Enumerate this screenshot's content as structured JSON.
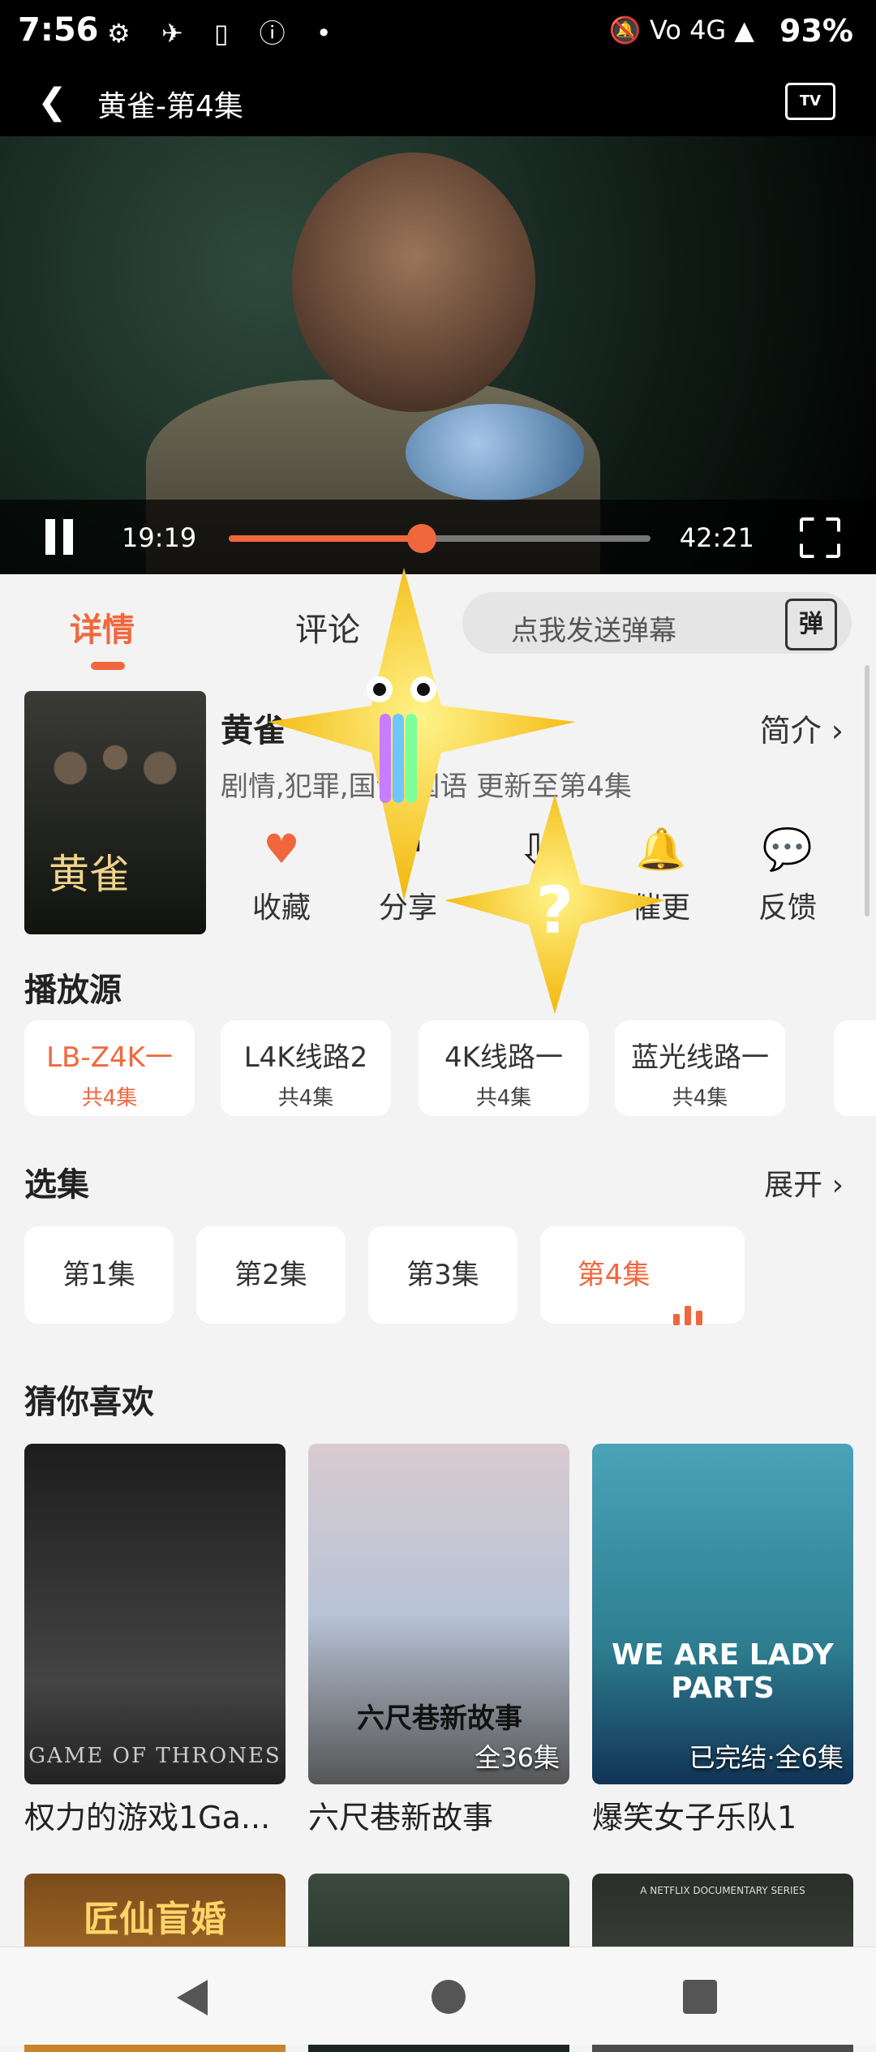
{
  "status_bar": {
    "time": "7:56",
    "left_icons": "⚙ ✈ ▯ ⓘ •",
    "right_icons": "🔕 Vo 4G ▲",
    "battery": "93%"
  },
  "top_bar": {
    "back_label": "❮",
    "title": "黄雀-第4集",
    "tv_label": "TV"
  },
  "player": {
    "current_time": "19:19",
    "total_time": "42:21",
    "progress_fraction": 0.457
  },
  "tabs": {
    "detail": "详情",
    "comment": "评论",
    "danmu_placeholder": "点我发送弹幕",
    "danmu_icon": "弹"
  },
  "show": {
    "title": "黄雀",
    "meta": "剧情,犯罪,国语 国语 更新至第4集",
    "intro_label": "简介 ›",
    "poster_title": "黄雀"
  },
  "actions": [
    {
      "label": "收藏",
      "icon": "heart-icon",
      "glyph": "♥"
    },
    {
      "label": "分享",
      "icon": "share-icon",
      "glyph": "↗"
    },
    {
      "label": "下载",
      "icon": "download-icon",
      "glyph": "⇩"
    },
    {
      "label": "催更",
      "icon": "bell-icon",
      "glyph": "🔔"
    },
    {
      "label": "反馈",
      "icon": "feedback-icon",
      "glyph": "💬"
    }
  ],
  "sources": {
    "title": "播放源",
    "items": [
      {
        "name": "LB-Z4K一",
        "count": "共4集"
      },
      {
        "name": "L4K线路2",
        "count": "共4集"
      },
      {
        "name": "4K线路一",
        "count": "共4集"
      },
      {
        "name": "蓝光线路一",
        "count": "共4集"
      }
    ]
  },
  "episodes": {
    "title": "选集",
    "expand_label": "展开 ›",
    "items": [
      "第1集",
      "第2集",
      "第3集",
      "第4集"
    ]
  },
  "recommend": {
    "title": "猜你喜欢",
    "items": [
      {
        "title": "权力的游戏1Ga...",
        "badge": "",
        "poster_text": "GAME OF THRONES"
      },
      {
        "title": "六尺巷新故事",
        "badge": "全36集",
        "poster_text": "六尺巷新故事"
      },
      {
        "title": "爆笑女子乐队1",
        "badge": "已完结·全6集",
        "poster_text": "WE ARE LADY PARTS"
      }
    ],
    "row2_texts": [
      "匠仙盲婚",
      "",
      "A NETFLIX DOCUMENTARY SERIES"
    ]
  },
  "colors": {
    "accent": "#f0673e"
  }
}
